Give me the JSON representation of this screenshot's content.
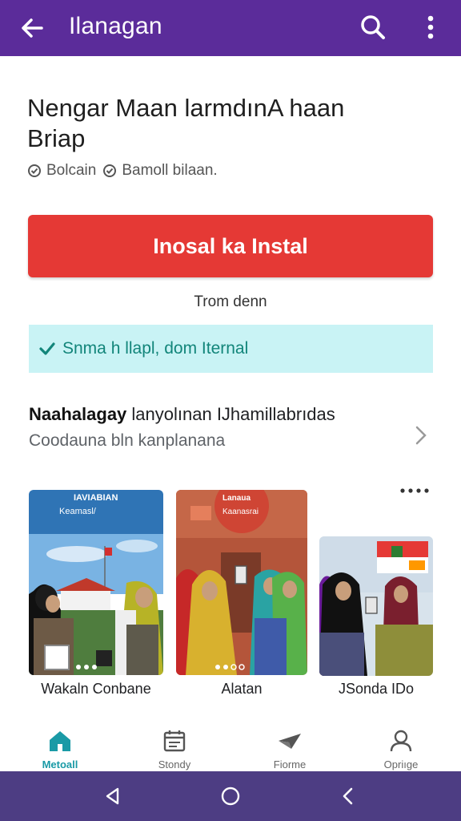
{
  "app_bar": {
    "title": "Ilanagan",
    "back_icon": "arrow-left-icon",
    "search_icon": "search-icon",
    "more_icon": "more-vert-icon",
    "color": "#5b2c9a"
  },
  "headline": {
    "line1": "Nengar Maan larmdınA haan",
    "line2": "Briap"
  },
  "meta": {
    "item1": "Bolcain",
    "item2": "Bamoll bilaan."
  },
  "install_button": {
    "label": "Inosal ka Instal",
    "color": "#e53935"
  },
  "sub_note": "Trom denn",
  "notice": {
    "text": "Snma h llapl, dom Iternal",
    "background": "#c9f3f5"
  },
  "description": {
    "bold": "Naahalagay",
    "rest": " lanyolınan IJhamillabrıdas",
    "secondary": "Coodauna bln kanplanana"
  },
  "gallery": {
    "cards": [
      {
        "caption": "Wakaln Conbane",
        "overlay_top": "IAVIABIAN",
        "overlay_sub": "Keamasl/"
      },
      {
        "caption": "Alatan",
        "overlay_top": "Lanaua",
        "overlay_sub": "Kaanasrai"
      },
      {
        "caption": "JSonda IDo",
        "overlay_top": "",
        "overlay_sub": ""
      }
    ]
  },
  "bottom_nav": {
    "items": [
      {
        "label": "Metoall",
        "icon": "home-icon",
        "active": true
      },
      {
        "label": "Stondy",
        "icon": "calendar-icon",
        "active": false
      },
      {
        "label": "Fiorme",
        "icon": "plane-icon",
        "active": false
      },
      {
        "label": "Opriıge",
        "icon": "profile-icon",
        "active": false
      }
    ]
  },
  "system_bar": {
    "back_icon": "triangle-back-icon",
    "home_icon": "circle-home-icon",
    "recents_icon": "chevron-left-icon",
    "color": "#4d3d83"
  }
}
